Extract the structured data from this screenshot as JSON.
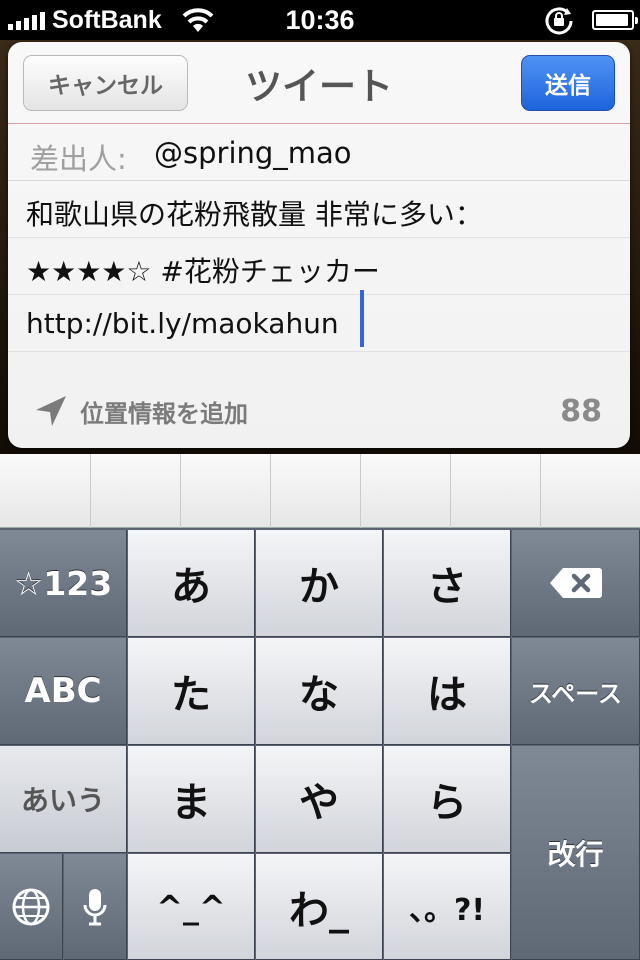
{
  "status_bar": {
    "carrier": "SoftBank",
    "time": "10:36",
    "battery_percent": 95,
    "signal_bars": 5
  },
  "tweet_sheet": {
    "title": "ツイート",
    "cancel_label": "キャンセル",
    "send_label": "送信",
    "from_label": "差出人:",
    "from_value": "@spring_mao",
    "body_lines": [
      "和歌山県の花粉飛散量 非常に多い：",
      "★★★★☆ #花粉チェッカー",
      "http://bit.ly/maokahun"
    ],
    "location_label": "位置情報を追加",
    "char_count": "88"
  },
  "keyboard": {
    "num_label": "☆123",
    "abc_label": "ABC",
    "kana_label": "あいう",
    "space_label": "スペース",
    "return_label": "改行",
    "keys": {
      "a": "あ",
      "ka": "か",
      "sa": "さ",
      "ta": "た",
      "na": "な",
      "ha": "は",
      "ma": "ま",
      "ya": "や",
      "ra": "ら",
      "kaomoji": "^_^",
      "wa": "わ_",
      "punct": "、。?!"
    }
  }
}
